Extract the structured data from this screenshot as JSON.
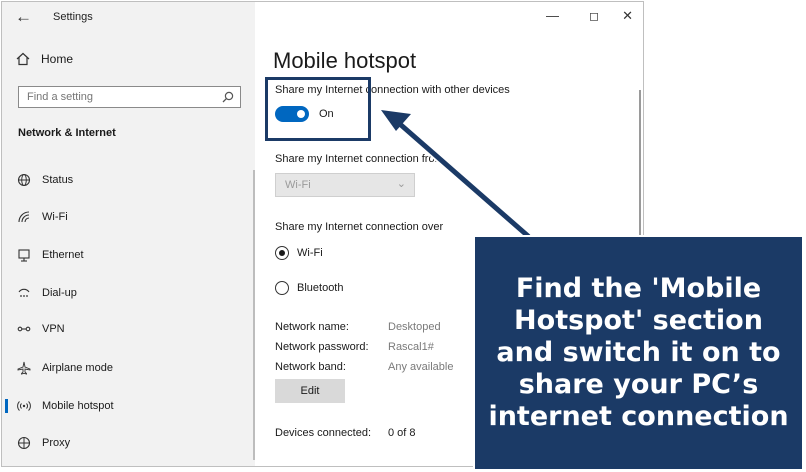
{
  "app": {
    "title": "Settings"
  },
  "sidebar": {
    "home_label": "Home",
    "search_placeholder": "Find a setting",
    "section_title": "Network & Internet",
    "items": [
      {
        "label": "Status",
        "icon": "globe-icon"
      },
      {
        "label": "Wi-Fi",
        "icon": "wifi-icon"
      },
      {
        "label": "Ethernet",
        "icon": "ethernet-icon"
      },
      {
        "label": "Dial-up",
        "icon": "dialup-icon"
      },
      {
        "label": "VPN",
        "icon": "vpn-icon"
      },
      {
        "label": "Airplane mode",
        "icon": "airplane-icon"
      },
      {
        "label": "Mobile hotspot",
        "icon": "hotspot-icon",
        "active": true
      },
      {
        "label": "Proxy",
        "icon": "proxy-icon"
      }
    ]
  },
  "main": {
    "title": "Mobile hotspot",
    "share_label": "Share my Internet connection with other devices",
    "toggle_state": "On",
    "share_from_label": "Share my Internet connection from",
    "share_from_value": "Wi-Fi",
    "share_over_label": "Share my Internet connection over",
    "share_over_options": [
      {
        "label": "Wi-Fi",
        "selected": true
      },
      {
        "label": "Bluetooth",
        "selected": false
      }
    ],
    "network_name_label": "Network name:",
    "network_name_value": "Desktoped",
    "network_password_label": "Network password:",
    "network_password_value": "Rascal1#",
    "network_band_label": "Network band:",
    "network_band_value": "Any available",
    "edit_label": "Edit",
    "devices_connected_label": "Devices connected:",
    "devices_connected_value": "0 of 8"
  },
  "callout": {
    "text": "Find the 'Mobile Hotspot' section and switch it on to share your PC’s internet connection"
  },
  "colors": {
    "accent": "#0067c0",
    "callout_bg": "#1b3a66"
  }
}
